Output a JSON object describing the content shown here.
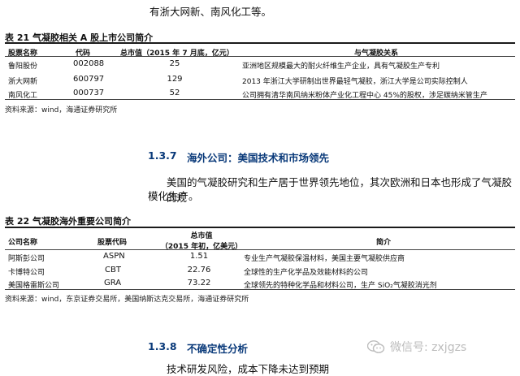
{
  "top_paragraph": "有浙大网新、南风化工等。",
  "table21": {
    "caption": "表 21 气凝胶相关 A 股上市公司简介",
    "headers": [
      "股票名称",
      "代码",
      "总市值（2015 年 7 月底，亿元）",
      "与气凝胶关系"
    ],
    "rows": [
      [
        "鲁阳股份",
        "002088",
        "25",
        "亚洲地区规模最大的耐火纤维生产企业，具有气凝胶生产专利"
      ],
      [
        "浙大网新",
        "600797",
        "129",
        "2013 年浙江大学研制出世界最轻气凝胶，浙江大学是公司实际控制人"
      ],
      [
        "南风化工",
        "000737",
        "52",
        "公司拥有清华南风纳米粉体产业化工程中心 45%的股权，涉足碳纳米管生产"
      ]
    ],
    "source": "资料来源：wind，海通证券研究所"
  },
  "section_137": {
    "number": "1.3.7",
    "title": "海外公司：美国技术和市场领先"
  },
  "section_137_paragraph_line1": "美国的气凝胶研究和生产居于世界领先地位，其次欧洲和日本也形成了气凝胶的规",
  "section_137_paragraph_line2": "模化生产。",
  "table22": {
    "caption": "表 22 气凝胶海外重要公司简介",
    "headers": [
      "公司名称",
      "股票代码",
      "总市值",
      "（2015 年初，亿美元）",
      "简介"
    ],
    "rows": [
      [
        "阿斯彭公司",
        "ASPN",
        "1.51",
        "专业生产气凝胶保温材料，美国主要气凝胶供应商"
      ],
      [
        "卡博特公司",
        "CBT",
        "22.76",
        "全球性的生产化学品及效能材料的公司"
      ],
      [
        "美国格雷斯公司",
        "GRA",
        "73.22",
        "全球领先的特种化学品和材料公司，生产 SiO₂气凝胶消光剂"
      ]
    ],
    "source": "资料来源：wind，东京证券交易所，美国纳斯达克交易所，海通证券研究所"
  },
  "section_138": {
    "number": "1.3.8",
    "title": "不确定性分析"
  },
  "section_138_paragraph": "技术研发风险，成本下降未达到预期",
  "watermark": {
    "icon": "wechat-icon",
    "text": "微信号: zxjgzs"
  }
}
